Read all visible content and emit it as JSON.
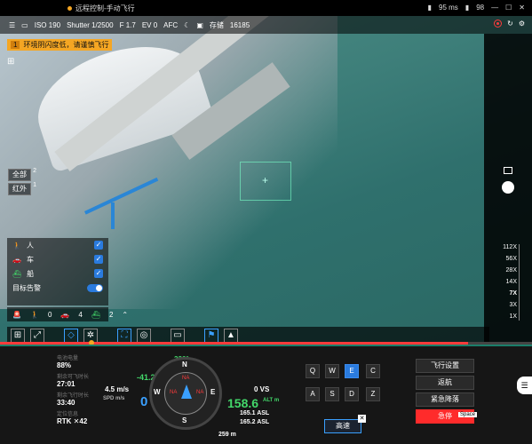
{
  "statusbar": {
    "app_title": "远程控制-手动飞行",
    "speed": "95 ms",
    "battery": "98"
  },
  "camera_info": {
    "items": [
      "ISO 190",
      "Shutter 1/2500",
      "F 1.7",
      "EV 0",
      "AFC",
      "存储",
      "16185"
    ]
  },
  "warning": {
    "count": "1",
    "text": "环境阴闪度低，请谨慎飞行"
  },
  "modes": [
    {
      "label": "全部",
      "badge": "2"
    },
    {
      "label": "红外",
      "badge": "1"
    }
  ],
  "detect": {
    "person": "人",
    "car": "车",
    "boat": "船",
    "target_alarm": "目标告警"
  },
  "counts": {
    "person": "0",
    "car": "4",
    "boat": "2"
  },
  "zoom": {
    "levels": [
      "112X",
      "56X",
      "28X",
      "14X",
      "7X",
      "3X",
      "1X"
    ],
    "selected": "7X"
  },
  "stats": [
    {
      "label": "电池电量",
      "value": "88%"
    },
    {
      "label": "剩余可飞时长",
      "value": "27:01"
    },
    {
      "label": "剩余飞行时长",
      "value": "33:40"
    },
    {
      "label": "定位信息",
      "value": "RTK ✕42"
    }
  ],
  "flight": {
    "heading": "336°",
    "pitch": "-41.2°",
    "wind_speed": "4.5 m/s",
    "speed": "0",
    "speed_unit": "SPD m/s",
    "vertical_speed": "0 VS",
    "altitude": "158.6",
    "altitude_unit": "ALT m",
    "asl1": "165.1 ASL",
    "asl2": "165.2 ASL",
    "distance": "259 m"
  },
  "compass": {
    "north": "N",
    "south": "S",
    "east": "E",
    "west": "W",
    "na": "NA"
  },
  "keys": [
    {
      "label": "Q"
    },
    {
      "label": "W"
    },
    {
      "label": "E",
      "active": true
    },
    {
      "label": "C"
    },
    {
      "label": "A"
    },
    {
      "label": "S"
    },
    {
      "label": "D"
    },
    {
      "label": "Z"
    }
  ],
  "speed_mode": "高速",
  "actions": {
    "flight_settings": "飞行设置",
    "return_home": "返航",
    "emergency_land": "紧急降落",
    "emergency_stop": "急停",
    "hotkey": "Space"
  },
  "colors": {
    "accent": "#2a7bde",
    "warning": "#f5a623",
    "danger": "#ff2b2b",
    "ok": "#43d86a"
  }
}
